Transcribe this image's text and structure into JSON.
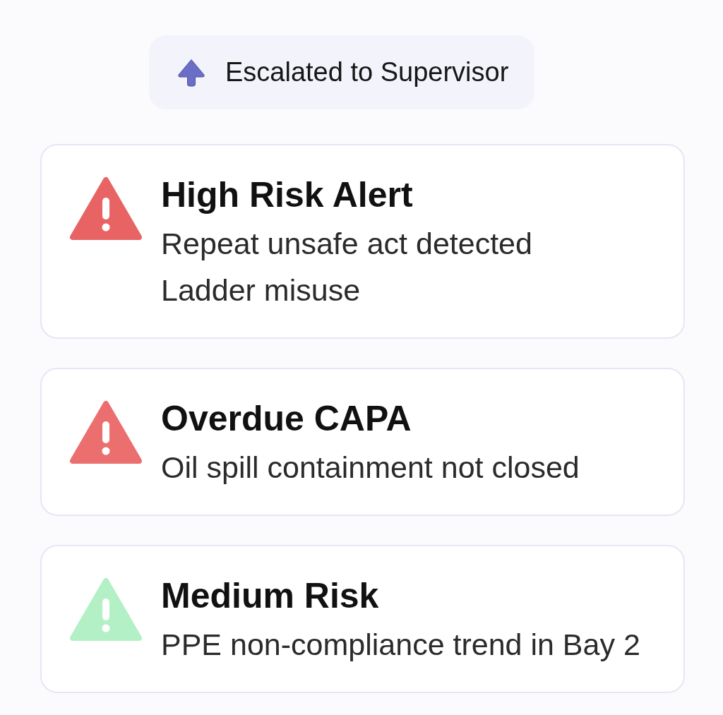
{
  "escalation": {
    "label": "Escalated to Supervisor"
  },
  "alerts": [
    {
      "title": "High Risk Alert",
      "lines": [
        "Repeat unsafe act detected",
        "Ladder misuse"
      ],
      "color": "#e86464"
    },
    {
      "title": "Overdue CAPA",
      "lines": [
        "Oil spill containment not closed"
      ],
      "color": "#ec6f6f"
    },
    {
      "title": "Medium Risk",
      "lines": [
        "PPE non-compliance trend in Bay 2"
      ],
      "color": "#b3f0c5"
    }
  ]
}
